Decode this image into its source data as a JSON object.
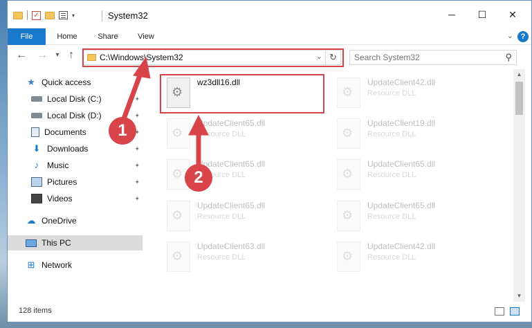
{
  "window": {
    "title": "System32",
    "controls": {
      "minimize": "─",
      "maximize": "☐",
      "close": "✕"
    }
  },
  "ribbon": {
    "tabs": [
      {
        "label": "File",
        "active": true
      },
      {
        "label": "Home"
      },
      {
        "label": "Share"
      },
      {
        "label": "View"
      }
    ],
    "help_label": "?"
  },
  "navbar": {
    "back": "←",
    "forward": "→",
    "recent": "▾",
    "up": "↑",
    "address": "C:\\Windows\\System32",
    "refresh": "↻",
    "search_placeholder": "Search System32",
    "search_icon": "search-icon"
  },
  "navpane": {
    "items": [
      {
        "label": "Quick access",
        "icon": "star-icon",
        "glyph": "★"
      },
      {
        "label": "Local Disk (C:)",
        "icon": "drive-icon",
        "pinned": true
      },
      {
        "label": "Local Disk (D:)",
        "icon": "drive-icon",
        "pinned": true
      },
      {
        "label": "Documents",
        "icon": "documents-icon",
        "pinned": true
      },
      {
        "label": "Downloads",
        "icon": "downloads-icon",
        "glyph": "⬇",
        "pinned": true
      },
      {
        "label": "Music",
        "icon": "music-icon",
        "glyph": "♪",
        "pinned": true
      },
      {
        "label": "Pictures",
        "icon": "pictures-icon",
        "pinned": true
      },
      {
        "label": "Videos",
        "icon": "videos-icon",
        "pinned": true
      },
      {
        "label": "OneDrive",
        "icon": "cloud-icon",
        "glyph": "☁"
      },
      {
        "label": "This PC",
        "icon": "computer-icon",
        "selected": true
      },
      {
        "label": "Network",
        "icon": "network-icon",
        "glyph": "⊞"
      }
    ],
    "pin_glyph": "📌"
  },
  "files": [
    {
      "name": "wz3dll16.dll",
      "type": "",
      "highlighted": true
    },
    {
      "name": "UpdateClient42.dll",
      "type": "Resource DLL"
    },
    {
      "name": "UpdateClient65.dll",
      "type": "Resource DLL"
    },
    {
      "name": "UpdateClient19.dll",
      "type": "Resource DLL"
    },
    {
      "name": "UpdateClient65.dll",
      "type": "Resource DLL"
    },
    {
      "name": "UpdateClient65.dll",
      "type": "Resource DLL"
    },
    {
      "name": "UpdateClient65.dll",
      "type": "Resource DLL"
    },
    {
      "name": "UpdateClient65.dll",
      "type": "Resource DLL"
    },
    {
      "name": "UpdateClient63.dll",
      "type": "Resource DLL"
    },
    {
      "name": "UpdateClient42.dll",
      "type": "Resource DLL"
    }
  ],
  "status": {
    "item_count": "128 items"
  },
  "annotations": {
    "marker1": "1",
    "marker2": "2",
    "color": "#d9434a"
  }
}
